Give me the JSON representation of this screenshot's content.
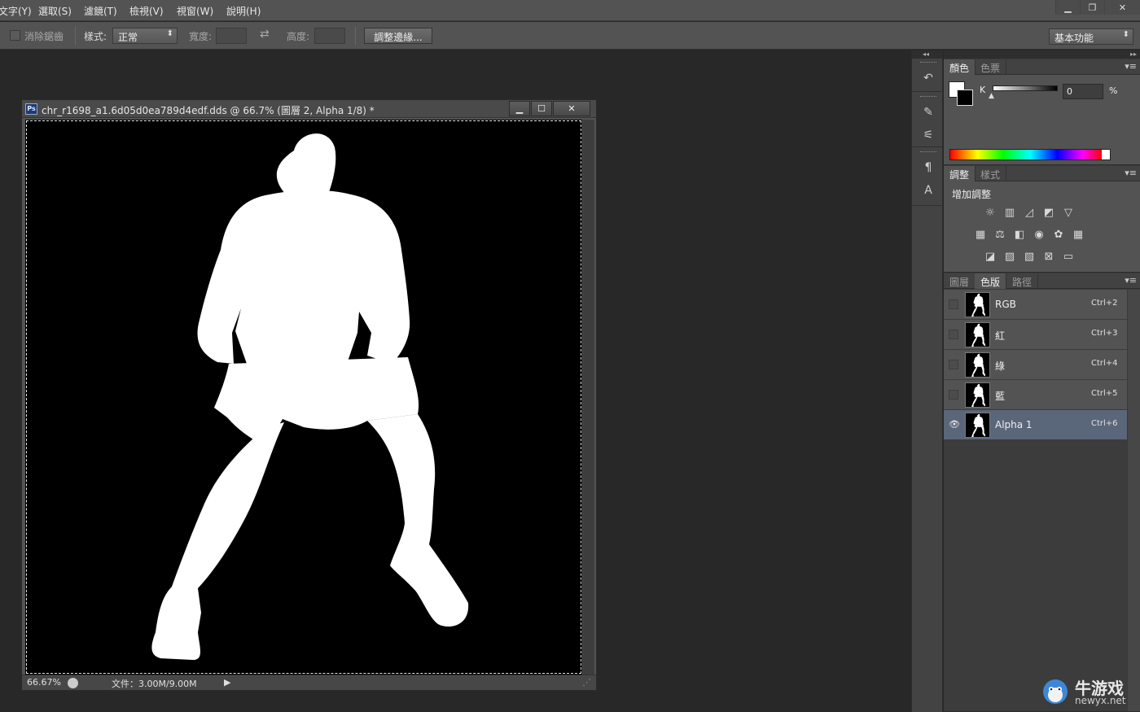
{
  "menu": [
    "文字(Y)",
    "選取(S)",
    "濾鏡(T)",
    "檢視(V)",
    "視窗(W)",
    "說明(H)"
  ],
  "window_controls": {
    "minimize": "▁",
    "restore": "❐",
    "close": "✕"
  },
  "options": {
    "antialias_label": "消除鋸齒",
    "style_label": "樣式:",
    "style_value": "正常",
    "width_label": "寬度:",
    "height_label": "高度:",
    "swap_icon": "⇄",
    "refine_edge_button": "調整邊緣...",
    "workspace_value": "基本功能"
  },
  "document": {
    "app_badge": "Ps",
    "title": "chr_r1698_a1.6d05d0ea789d4edf.dds @ 66.7% (圖層 2, Alpha 1/8) *",
    "zoom": "66.67%",
    "file_info": "文件：3.00M/9.00M"
  },
  "color_panel": {
    "tabs": [
      "顏色",
      "色票"
    ],
    "channel_label": "K",
    "k_value": "0",
    "percent": "%",
    "k_level": 0
  },
  "adjustments_panel": {
    "tabs": [
      "調整",
      "樣式"
    ],
    "title": "增加調整"
  },
  "channels_panel": {
    "tabs": [
      "圖層",
      "色版",
      "路徑"
    ],
    "active_tab": 1,
    "channels": [
      {
        "name": "RGB",
        "shortcut": "Ctrl+2",
        "visible": false,
        "selected": false
      },
      {
        "name": "紅",
        "shortcut": "Ctrl+3",
        "visible": false,
        "selected": false
      },
      {
        "name": "綠",
        "shortcut": "Ctrl+4",
        "visible": false,
        "selected": false
      },
      {
        "name": "藍",
        "shortcut": "Ctrl+5",
        "visible": false,
        "selected": false
      },
      {
        "name": "Alpha 1",
        "shortcut": "Ctrl+6",
        "visible": true,
        "selected": true
      }
    ]
  },
  "watermark": {
    "text": "牛游戏",
    "url": "newyx.net"
  },
  "colors": {
    "selected_row": "#5a6679",
    "panel": "#535353",
    "workspace": "#282828"
  }
}
